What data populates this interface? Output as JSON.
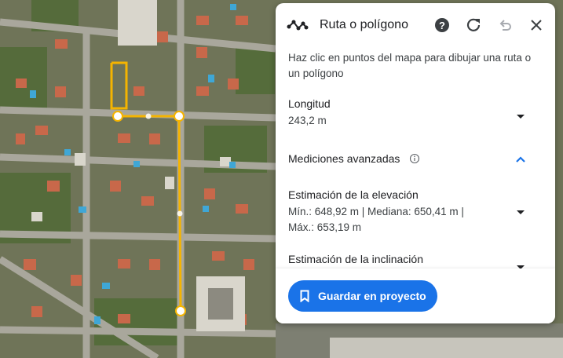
{
  "panel": {
    "title": "Ruta o polígono",
    "intro": "Haz clic en puntos del mapa para dibujar una ruta o un polígono",
    "length": {
      "label": "Longitud",
      "value": "243,2 m"
    },
    "advanced": {
      "label": "Mediciones avanzadas"
    },
    "elevation": {
      "label": "Estimación de la elevación",
      "value": "Mín.: 648,92 m | Mediana: 650,41 m | Máx.: 653,19 m"
    },
    "slope": {
      "label": "Estimación de la inclinación"
    },
    "save_label": "Guardar en proyecto"
  },
  "icons": {
    "route": "route-path-icon",
    "help": "help-icon",
    "refresh": "refresh-icon",
    "undo": "undo-icon",
    "close": "close-icon",
    "info": "info-icon",
    "bookmark": "bookmark-icon"
  },
  "colors": {
    "accent": "#1a73e8",
    "route_line": "#f5b400"
  }
}
